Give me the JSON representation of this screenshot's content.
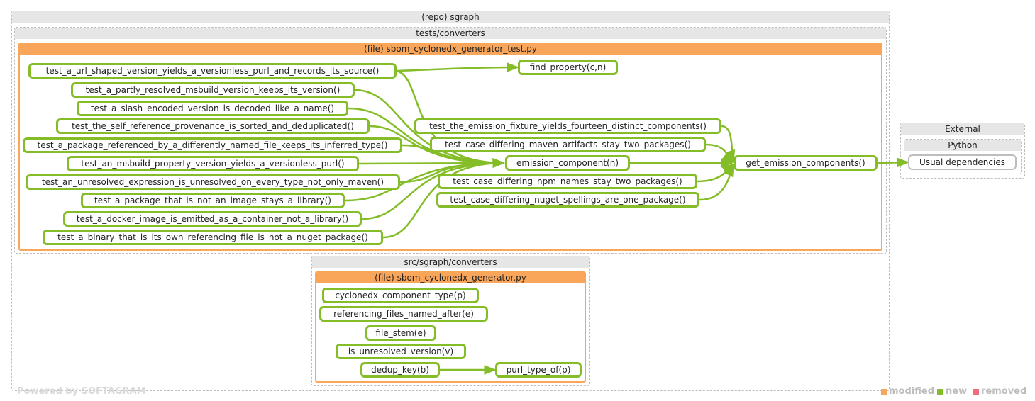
{
  "clusters": {
    "repo": "(repo) sgraph",
    "tests_dir": "tests/converters",
    "test_file": "(file) sbom_cyclonedx_generator_test.py",
    "src_dir": "src/sgraph/converters",
    "src_file": "(file) sbom_cyclonedx_generator.py",
    "external": "External",
    "python": "Python"
  },
  "test_nodes": [
    "test_a_url_shaped_version_yields_a_versionless_purl_and_records_its_source()",
    "test_a_partly_resolved_msbuild_version_keeps_its_version()",
    "test_a_slash_encoded_version_is_decoded_like_a_name()",
    "test_the_self_reference_provenance_is_sorted_and_deduplicated()",
    "test_a_package_referenced_by_a_differently_named_file_keeps_its_inferred_type()",
    "test_an_msbuild_property_version_yields_a_versionless_purl()",
    "test_an_unresolved_expression_is_unresolved_on_every_type_not_only_maven()",
    "test_a_package_that_is_not_an_image_stays_a_library()",
    "test_a_docker_image_is_emitted_as_a_container_not_a_library()",
    "test_a_binary_that_is_its_own_referencing_file_is_not_a_nuget_package()"
  ],
  "mid_nodes": {
    "find_property": "find_property(c,n)",
    "fourteen": "test_the_emission_fixture_yields_fourteen_distinct_components()",
    "maven": "test_case_differing_maven_artifacts_stay_two_packages()",
    "emission_component": "emission_component(n)",
    "npm": "test_case_differing_npm_names_stay_two_packages()",
    "nuget": "test_case_differing_nuget_spellings_are_one_package()",
    "get_emission": "get_emission_components()"
  },
  "src_nodes": [
    "cyclonedx_component_type(p)",
    "referencing_files_named_after(e)",
    "file_stem(e)",
    "is_unresolved_version(v)",
    "dedup_key(b)",
    "purl_type_of(p)"
  ],
  "external_nodes": [
    "Usual dependencies"
  ],
  "footer": {
    "powered_by": "Powered by SOFTAGRAM",
    "legend_modified": "modified",
    "legend_new": "new",
    "legend_removed": "removed"
  },
  "colors": {
    "new": "#84bd28",
    "modified": "#f9a65a",
    "removed": "#f06a7d",
    "cluster_header": "#e6e6e6"
  }
}
